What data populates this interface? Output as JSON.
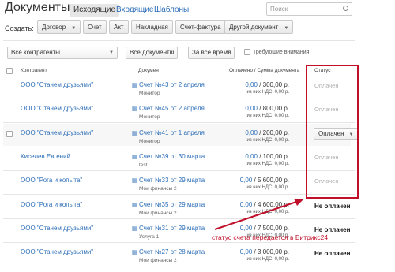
{
  "header": {
    "title": "Документы",
    "tabs": [
      {
        "label": "Исходящие",
        "active": true
      },
      {
        "label": "Входящие",
        "active": false
      },
      {
        "label": "Шаблоны",
        "active": false
      }
    ],
    "search_placeholder": "Поиск"
  },
  "create_bar": {
    "label": "Создать:",
    "buttons": [
      "Договор",
      "Счет",
      "Акт",
      "Накладная",
      "Счет-фактура",
      "Другой документ"
    ]
  },
  "filters": {
    "contractors": "Все контрагенты",
    "documents": "Все документы",
    "period": "За все время",
    "attention_label": "Требующие внимания"
  },
  "columns": {
    "contractor": "Контрагент",
    "document": "Документ",
    "amount": "Оплачено / Сумма документа",
    "status": "Статус"
  },
  "rows": [
    {
      "contractor": "ООО \"Станем друзьями\"",
      "doc_title": "Счет №43 от 2 апреля",
      "doc_sub": "Монитор",
      "paid": "0,00",
      "total": "/ 300,00 р.",
      "vat": "из них НДС: 0,00 р.",
      "status": "Оплачен",
      "status_style": "ghost"
    },
    {
      "contractor": "ООО \"Станем друзьями\"",
      "doc_title": "Счет №45 от 2 апреля",
      "doc_sub": "Монитор",
      "paid": "0,00",
      "total": "/ 800,00 р.",
      "vat": "из них НДС: 0,00 р.",
      "status": "Оплачен",
      "status_style": "ghost"
    },
    {
      "contractor": "ООО \"Станем друзьями\"",
      "doc_title": "Счет №41 от 1 апреля",
      "doc_sub": "Монитор",
      "paid": "0,00",
      "total": "/ 200,00 р.",
      "vat": "из них НДС: 0,00 р.",
      "status": "Оплачен",
      "status_style": "button"
    },
    {
      "contractor": "Киселев Евгений",
      "doc_title": "Счет №39 от 30 марта",
      "doc_sub": "test",
      "paid": "0,00",
      "total": "/ 100,00 р.",
      "vat": "из них НДС: 0,00 р.",
      "status": "Оплачен",
      "status_style": "ghost"
    },
    {
      "contractor": "ООО \"Рога и копыта\"",
      "doc_title": "Счет №33 от 29 марта",
      "doc_sub": "Мои финансы 2",
      "paid": "0,00",
      "total": "/ 5 600,00 р.",
      "vat": "из них НДС: 0,00 р.",
      "status": "Оплачен",
      "status_style": "ghost"
    },
    {
      "contractor": "ООО \"Рога и копыта\"",
      "doc_title": "Счет №35 от 29 марта",
      "doc_sub": "Мои финансы 2",
      "paid": "0,00",
      "total": "/ 4 600,00 р.",
      "vat": "из них НДС: 0,00 р.",
      "status": "Не оплачен",
      "status_style": "bold"
    },
    {
      "contractor": "ООО \"Станем друзьями\"",
      "doc_title": "Счет №31 от 29 марта",
      "doc_sub": "Услуга 1",
      "paid": "0,00",
      "total": "/ 7 500,00 р.",
      "vat": "из них НДС: 0,00 р.",
      "status": "Не оплачен",
      "status_style": "bold"
    },
    {
      "contractor": "ООО \"Станем друзьями\"",
      "doc_title": "Счет №27 от 28 марта",
      "doc_sub": "Мои финансы 2",
      "paid": "0,00",
      "total": "/ 3 000,00 р.",
      "vat": "из них НДС: 0,00 р.",
      "status": "Не оплачен",
      "status_style": "bold"
    }
  ],
  "annotation": {
    "text": "статус счета передается в Битрикс24",
    "color": "#c0102a"
  },
  "colors": {
    "link": "#2b6db7",
    "annotation_red": "#c0102a"
  }
}
